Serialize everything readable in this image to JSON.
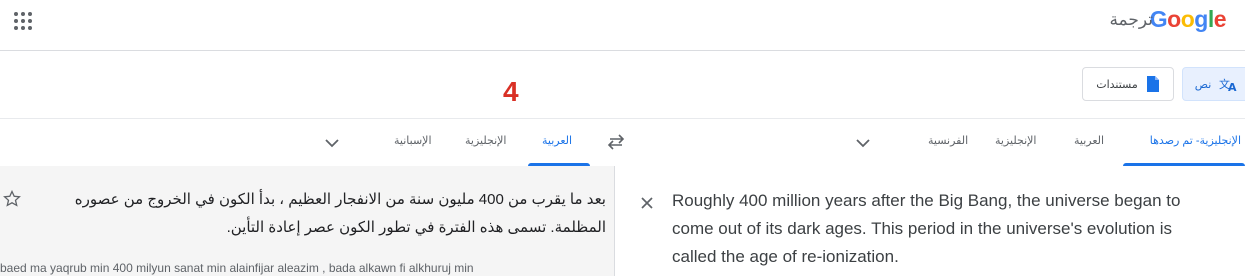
{
  "header": {
    "logo_letters": [
      "G",
      "o",
      "o",
      "g",
      "l",
      "e"
    ],
    "brand_suffix": "ترجمة",
    "apps_icon": "apps-grid-icon"
  },
  "modes": {
    "text_label": "نص",
    "docs_label": "مستندات"
  },
  "step_marker": "4",
  "source_langs": {
    "detected": "الإنجليزية- تم رصدها",
    "items": [
      "العربية",
      "الإنجليزية",
      "الفرنسية"
    ]
  },
  "target_langs": {
    "items": [
      "العربية",
      "الإنجليزية",
      "الإسبانية"
    ],
    "active_index": 0
  },
  "source": {
    "text": "Roughly 400 million years after the Big Bang, the universe began to come out of its dark ages. This period in the universe's evolution is called the age of re-ionization."
  },
  "target": {
    "text": "بعد ما يقرب من 400 مليون سنة من الانفجار العظيم ، بدأ الكون في الخروج من عصوره المظلمة. تسمى هذه الفترة في تطور الكون عصر إعادة التأين.",
    "transliteration": "baed ma yaqrub min 400 milyun sanat min alainfijar aleazim , bada alkawn fi alkhuruj min"
  },
  "colors": {
    "accent": "#1a73e8",
    "marker": "#d93025"
  }
}
